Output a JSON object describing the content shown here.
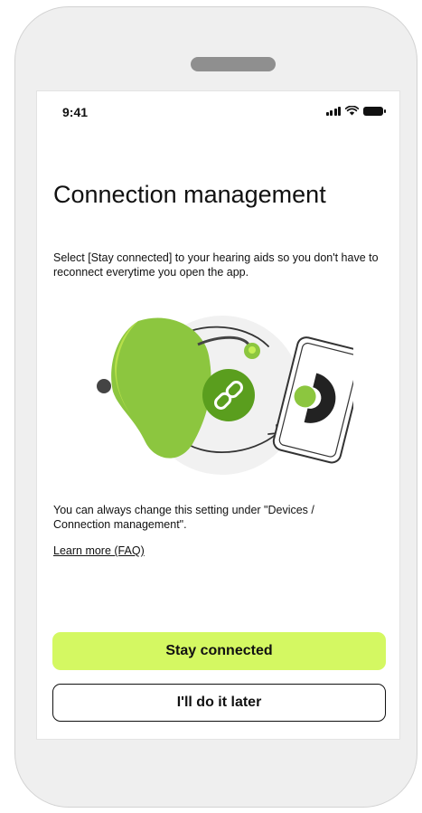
{
  "status_bar": {
    "time": "9:41",
    "icons": [
      "signal-icon",
      "wifi-icon",
      "battery-icon"
    ]
  },
  "page": {
    "title": "Connection management",
    "intro": "Select [Stay connected] to your hearing aids so you don't have to reconnect everytime you open the app.",
    "note": "You can always change this setting under \"Devices / Connection management\".",
    "faq_link": "Learn more (FAQ)"
  },
  "illustration": {
    "icons": [
      "hearing-aid-icon",
      "link-icon",
      "phone-icon",
      "sync-arrows-icon"
    ]
  },
  "actions": {
    "primary_label": "Stay connected",
    "secondary_label": "I'll do it later"
  },
  "colors": {
    "accent": "#d4f862",
    "hearing_aid_green": "#8cc63f",
    "link_circle": "#5a9e1e",
    "text": "#111111"
  }
}
